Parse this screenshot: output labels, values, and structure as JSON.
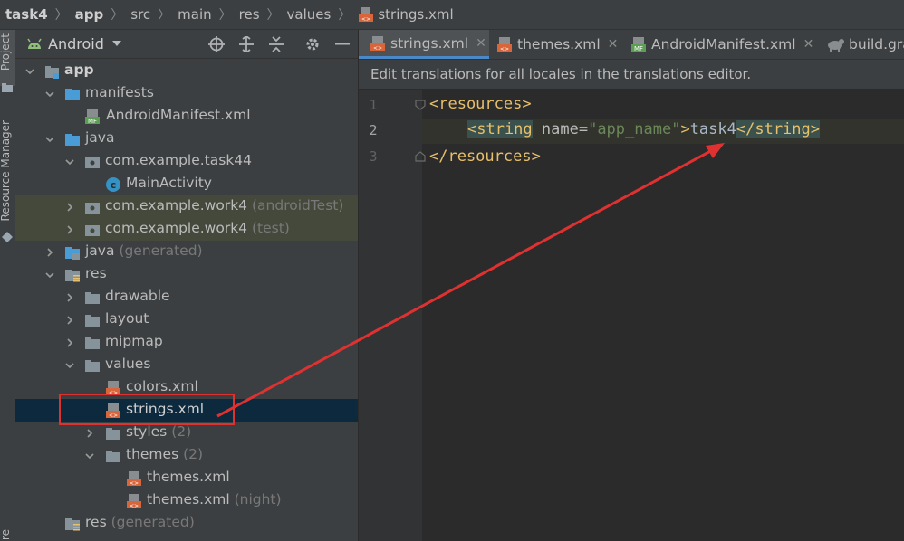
{
  "breadcrumb": [
    "task4",
    "app",
    "src",
    "main",
    "res",
    "values",
    "strings.xml"
  ],
  "left_stripe": {
    "project_label": "Project",
    "resource_manager_label": "Resource Manager",
    "bottom_label": "re"
  },
  "project_panel": {
    "title": "Android",
    "tree": [
      {
        "label": "app",
        "suffix": ""
      },
      {
        "label": "manifests",
        "suffix": ""
      },
      {
        "label": "AndroidManifest.xml",
        "suffix": ""
      },
      {
        "label": "java",
        "suffix": ""
      },
      {
        "label": "com.example.task44",
        "suffix": ""
      },
      {
        "label": "MainActivity",
        "suffix": ""
      },
      {
        "label": "com.example.work4",
        "suffix": "(androidTest)"
      },
      {
        "label": "com.example.work4",
        "suffix": "(test)"
      },
      {
        "label": "java",
        "suffix": "(generated)"
      },
      {
        "label": "res",
        "suffix": ""
      },
      {
        "label": "drawable",
        "suffix": ""
      },
      {
        "label": "layout",
        "suffix": ""
      },
      {
        "label": "mipmap",
        "suffix": ""
      },
      {
        "label": "values",
        "suffix": ""
      },
      {
        "label": "colors.xml",
        "suffix": ""
      },
      {
        "label": "strings.xml",
        "suffix": ""
      },
      {
        "label": "styles",
        "suffix": "(2)"
      },
      {
        "label": "themes",
        "suffix": "(2)"
      },
      {
        "label": "themes.xml",
        "suffix": ""
      },
      {
        "label": "themes.xml",
        "suffix": "(night)"
      },
      {
        "label": "res",
        "suffix": "(generated)"
      }
    ]
  },
  "editor": {
    "tabs": [
      "strings.xml",
      "themes.xml",
      "AndroidManifest.xml",
      "build.gra"
    ],
    "notification": "Edit translations for all locales in the translations editor.",
    "line_numbers": [
      "1",
      "2",
      "3"
    ],
    "code": {
      "l1_tag": "<resources>",
      "l2_open": "<string",
      "l2_attr": " name=",
      "l2_val": "\"app_name\"",
      "l2_gt": ">",
      "l2_text": "task4",
      "l2_close": "</string>",
      "l3_tag": "</resources>"
    }
  },
  "colors": {
    "selection": "#0d293e",
    "highlight_box": "#e03131",
    "tab_underline": "#4a88c7"
  }
}
